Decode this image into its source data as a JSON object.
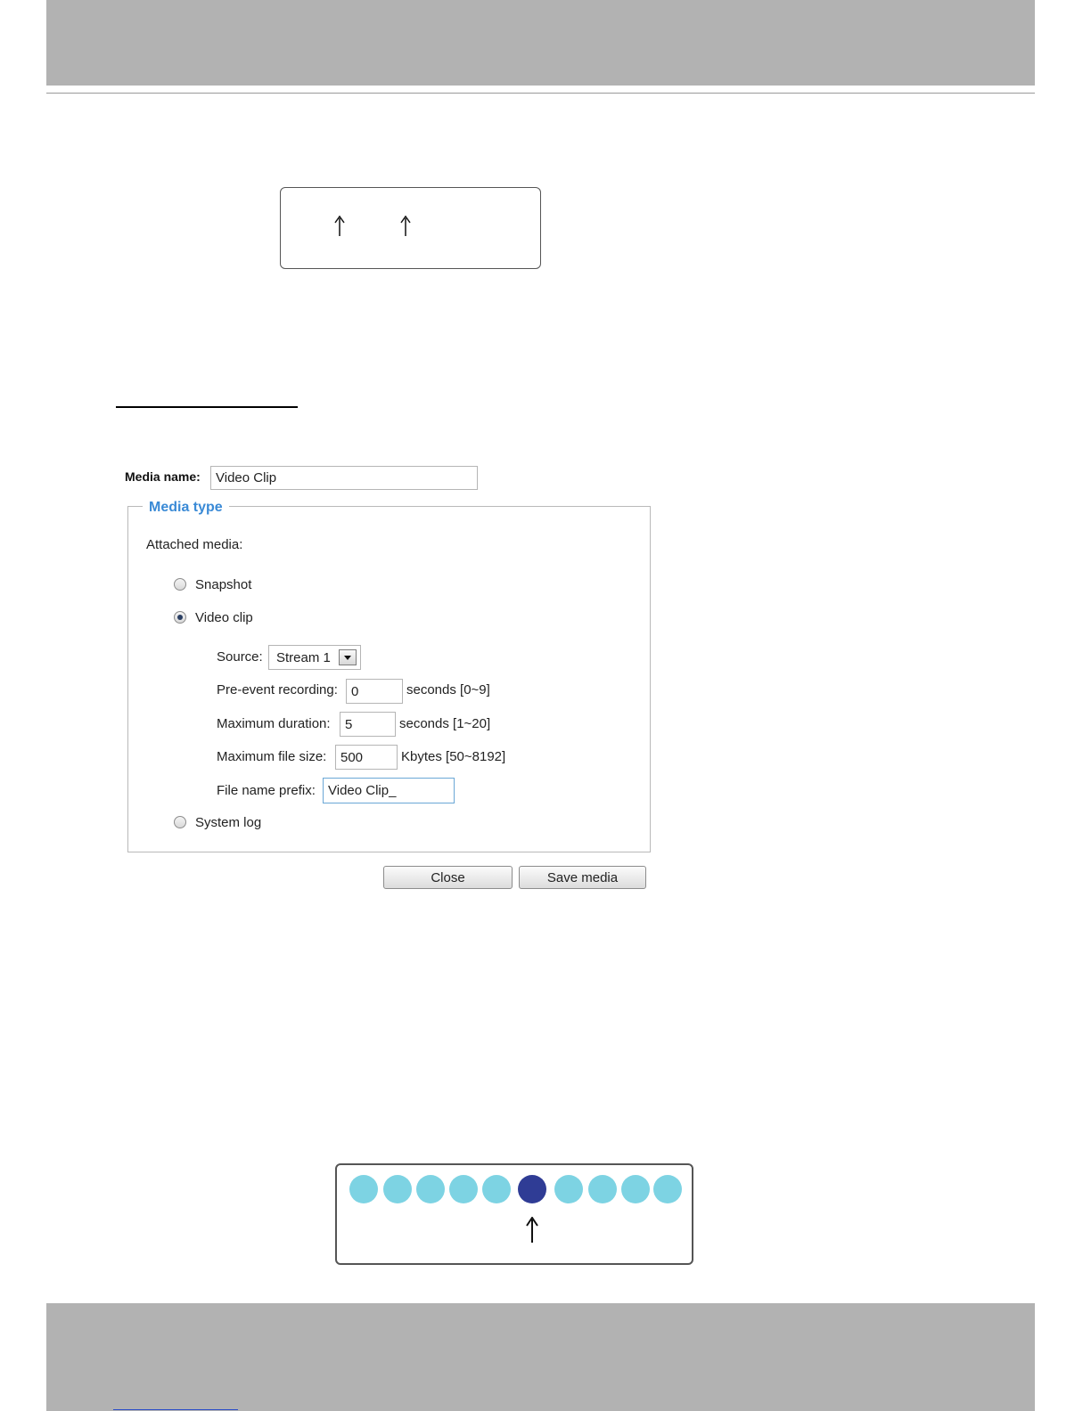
{
  "dialog": {
    "media_name_label": "Media name:",
    "media_name_value": "Video Clip",
    "legend": "Media type",
    "attached_media_label": "Attached media:",
    "options": {
      "snapshot": "Snapshot",
      "video_clip": "Video clip",
      "system_log": "System log"
    },
    "selected_option": "video_clip",
    "source_label": "Source:",
    "source_value": "Stream 1",
    "pre_event_label": "Pre-event recording:",
    "pre_event_value": "0",
    "pre_event_unit": "seconds [0~9]",
    "max_duration_label": "Maximum duration:",
    "max_duration_value": "5",
    "max_duration_unit": "seconds [1~20]",
    "max_file_size_label": "Maximum file size:",
    "max_file_size_value": "500",
    "max_file_size_unit": "Kbytes [50~8192]",
    "file_prefix_label": "File name prefix:",
    "file_prefix_value": "Video Clip_",
    "close_button": "Close",
    "save_button": "Save media"
  },
  "colors": {
    "band_gray": "#b2b2b2",
    "legend_blue": "#3a8ad6",
    "dot_light": "#7dd3e3",
    "dot_selected": "#2f3c95"
  },
  "timeline": {
    "dot_count": 10,
    "selected_index": 5
  }
}
